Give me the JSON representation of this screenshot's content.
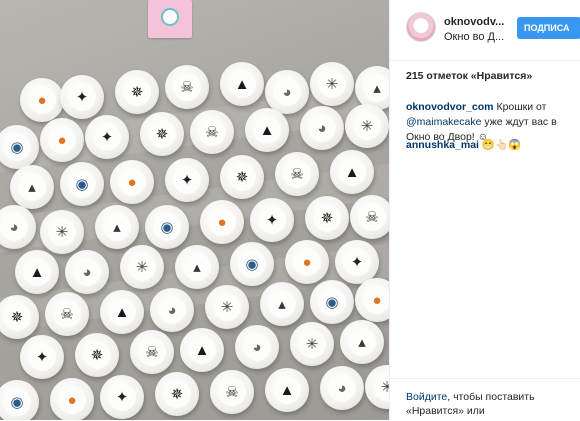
{
  "post": {
    "username": "oknovodv...",
    "location": "Окно во Д...",
    "follow_label": "ПОДПИСА",
    "likes_text": "215 отметок «Нравится»",
    "caption_user": "oknovodvor_com",
    "caption_text_1": " Крошки от ",
    "caption_mention": "@maimakecake",
    "caption_text_2": " уже ждут вас в Окно во Двор! ☺",
    "comment_user": "annushka_mai",
    "comment_text": " 😁👆🏻😱",
    "login_link": "Войдите",
    "login_text": ", чтобы поставить «Нравится» или"
  },
  "photo": {
    "description_icons": [
      "pumpkin-icon",
      "bat-icon",
      "spider-icon",
      "skull-icon",
      "cat-icon",
      "ghost-icon",
      "web-icon",
      "witch-hat-icon",
      "owl-icon"
    ],
    "colors": {
      "frosting": "#f3f2ef",
      "table": "#a9a6a1",
      "card": "#f5c2da"
    }
  },
  "colors": {
    "accent": "#3897f0",
    "link": "#003569",
    "text": "#262626"
  }
}
